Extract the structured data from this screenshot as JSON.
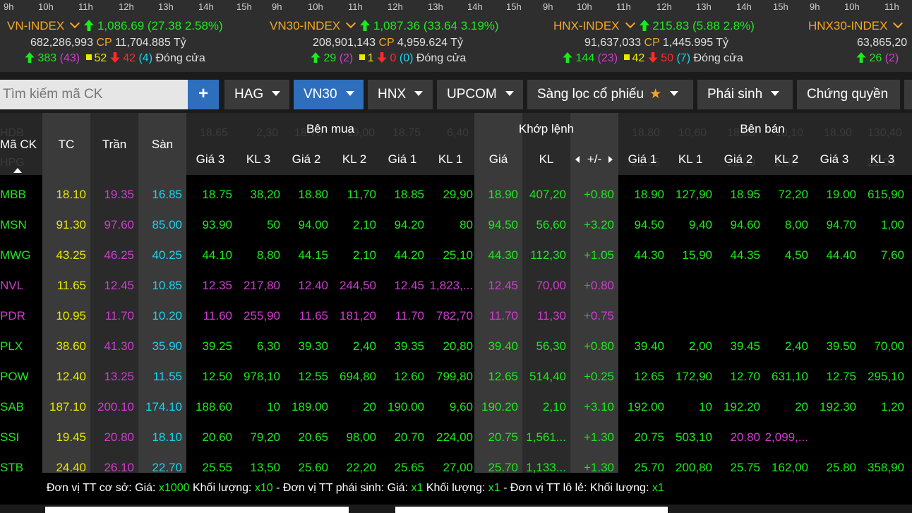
{
  "indices": [
    {
      "name": "VN-INDEX",
      "value": "1,086.69",
      "change": "(27.38 2.58%)",
      "volume": "682,286,993",
      "cp_label": "CP",
      "turnover": "11,704.885 Tỷ",
      "up": "383",
      "ceiling": "(43)",
      "unchanged": "52",
      "down": "42",
      "floor": "(4)",
      "status": "Đóng cửa",
      "hours": [
        "9h",
        "10h",
        "11h",
        "12h",
        "13h",
        "14h",
        "15h"
      ]
    },
    {
      "name": "VN30-INDEX",
      "value": "1,087.36",
      "change": "(33.64 3.19%)",
      "volume": "208,901,143",
      "cp_label": "CP",
      "turnover": "4,959.624 Tỷ",
      "up": "29",
      "ceiling": "(2)",
      "unchanged": "1",
      "down": "0",
      "floor": "(0)",
      "status": "Đóng cửa",
      "hours": [
        "9h",
        "10h",
        "11h",
        "12h",
        "13h",
        "14h",
        "15h"
      ]
    },
    {
      "name": "HNX-INDEX",
      "value": "215.83",
      "change": "(5.88 2.8%)",
      "volume": "91,637,033",
      "cp_label": "CP",
      "turnover": "1,445.995 Tỷ",
      "up": "144",
      "ceiling": "(23)",
      "unchanged": "42",
      "down": "50",
      "floor": "(7)",
      "status": "Đóng cửa",
      "hours": [
        "9h",
        "10h",
        "11h",
        "12h",
        "13h",
        "14h",
        "15h"
      ]
    },
    {
      "name": "HNX30-INDEX",
      "value": "",
      "change": "",
      "volume": "63,865,20",
      "cp_label": "",
      "turnover": "",
      "up": "26",
      "ceiling": "(2)",
      "unchanged": "",
      "down": "",
      "floor": "",
      "status": "",
      "hours": [
        "9h",
        "10h",
        "11h"
      ]
    }
  ],
  "toolbar": {
    "search_placeholder": "Tìm kiếm mã CK",
    "plus_label": "+",
    "buttons": [
      "HAG",
      "VN30",
      "HNX",
      "UPCOM",
      "Sàng lọc cổ phiếu",
      "Phái sinh",
      "Chứng quyền"
    ],
    "active_button": "VN30"
  },
  "table": {
    "headers": {
      "symbol": "Mã CK",
      "ref": "TC",
      "ceil": "Trần",
      "floor": "Sàn",
      "buy_group": "Bên mua",
      "match_group": "Khớp lệnh",
      "sell_group": "Bên bán",
      "price3": "Giá 3",
      "vol3": "KL 3",
      "price2": "Giá 2",
      "vol2": "KL 2",
      "price1": "Giá 1",
      "vol1": "KL 1",
      "match_price": "Giá",
      "match_vol": "KL",
      "change": "+/-"
    },
    "ghost_rows": [
      {
        "sym": "HDB",
        "vals": [
          "18.65",
          "2,30",
          "18.70",
          "19,00",
          "18.75",
          "6,40",
          "",
          "",
          "",
          "18.80",
          "10,60",
          "18.85",
          "10,10",
          "18.90",
          "130,40"
        ]
      },
      {
        "sym": "HPG",
        "vals": [
          "21.00",
          "",
          "",
          "",
          "",
          "",
          "",
          "",
          "",
          "21.95",
          "",
          "22.00",
          "2,85",
          "",
          "22.05"
        ]
      }
    ],
    "rows": [
      {
        "sym": "MBB",
        "tc": "18.10",
        "tran": "19.35",
        "san": "16.85",
        "b3": "18.75",
        "bv3": "38,20",
        "b2": "18.80",
        "bv2": "11,70",
        "b1": "18.85",
        "bv1": "29,90",
        "mp": "18.90",
        "mv": "407,20",
        "ch": "+0.80",
        "s1": "18.90",
        "sv1": "127,90",
        "s2": "18.95",
        "sv2": "72,20",
        "s3": "19.00",
        "sv3": "615,90",
        "color": "green"
      },
      {
        "sym": "MSN",
        "tc": "91.30",
        "tran": "97.60",
        "san": "85.00",
        "b3": "93.90",
        "bv3": "50",
        "b2": "94.00",
        "bv2": "2,10",
        "b1": "94.20",
        "bv1": "80",
        "mp": "94.50",
        "mv": "56,60",
        "ch": "+3.20",
        "s1": "94.50",
        "sv1": "9,40",
        "s2": "94.60",
        "sv2": "8,00",
        "s3": "94.70",
        "sv3": "1,00",
        "color": "green"
      },
      {
        "sym": "MWG",
        "tc": "43.25",
        "tran": "46.25",
        "san": "40.25",
        "b3": "44.10",
        "bv3": "8,80",
        "b2": "44.15",
        "bv2": "2,10",
        "b1": "44.20",
        "bv1": "25,10",
        "mp": "44.30",
        "mv": "112,30",
        "ch": "+1.05",
        "s1": "44.30",
        "sv1": "15,90",
        "s2": "44.35",
        "sv2": "4,50",
        "s3": "44.40",
        "sv3": "7,60",
        "color": "green"
      },
      {
        "sym": "NVL",
        "tc": "11.65",
        "tran": "12.45",
        "san": "10.85",
        "b3": "12.35",
        "bv3": "217,80",
        "b2": "12.40",
        "bv2": "244,50",
        "b1": "12.45",
        "bv1": "1,823,...",
        "mp": "12.45",
        "mv": "70,00",
        "ch": "+0.80",
        "s1": "",
        "sv1": "",
        "s2": "",
        "sv2": "",
        "s3": "",
        "sv3": "",
        "color": "purple"
      },
      {
        "sym": "PDR",
        "tc": "10.95",
        "tran": "11.70",
        "san": "10.20",
        "b3": "11.60",
        "bv3": "255,90",
        "b2": "11.65",
        "bv2": "181,20",
        "b1": "11.70",
        "bv1": "782,70",
        "mp": "11.70",
        "mv": "11,30",
        "ch": "+0.75",
        "s1": "",
        "sv1": "",
        "s2": "",
        "sv2": "",
        "s3": "",
        "sv3": "",
        "color": "purple"
      },
      {
        "sym": "PLX",
        "tc": "38.60",
        "tran": "41.30",
        "san": "35.90",
        "b3": "39.25",
        "bv3": "6,30",
        "b2": "39.30",
        "bv2": "2,40",
        "b1": "39.35",
        "bv1": "20,80",
        "mp": "39.40",
        "mv": "56,30",
        "ch": "+0.80",
        "s1": "39.40",
        "sv1": "2,00",
        "s2": "39.45",
        "sv2": "2,40",
        "s3": "39.50",
        "sv3": "70,00",
        "color": "green"
      },
      {
        "sym": "POW",
        "tc": "12.40",
        "tran": "13.25",
        "san": "11.55",
        "b3": "12.50",
        "bv3": "978,10",
        "b2": "12.55",
        "bv2": "694,80",
        "b1": "12.60",
        "bv1": "799,80",
        "mp": "12.65",
        "mv": "514,40",
        "ch": "+0.25",
        "s1": "12.65",
        "sv1": "172,90",
        "s2": "12.70",
        "sv2": "631,10",
        "s3": "12.75",
        "sv3": "295,10",
        "color": "green"
      },
      {
        "sym": "SAB",
        "tc": "187.10",
        "tran": "200.10",
        "san": "174.10",
        "b3": "188.60",
        "bv3": "10",
        "b2": "189.00",
        "bv2": "20",
        "b1": "190.00",
        "bv1": "9,60",
        "mp": "190.20",
        "mv": "2,10",
        "ch": "+3.10",
        "s1": "192.00",
        "sv1": "10",
        "s2": "192.20",
        "sv2": "20",
        "s3": "192.30",
        "sv3": "1,20",
        "color": "green"
      },
      {
        "sym": "SSI",
        "tc": "19.45",
        "tran": "20.80",
        "san": "18.10",
        "b3": "20.60",
        "bv3": "79,20",
        "b2": "20.65",
        "bv2": "98,00",
        "b1": "20.70",
        "bv1": "224,00",
        "mp": "20.75",
        "mv": "1,561...",
        "ch": "+1.30",
        "s1": "20.75",
        "sv1": "503,10",
        "s2": "20.80",
        "sv2": "2,099,...",
        "s3": "",
        "sv3": "",
        "color": "green",
        "s2color": "purple"
      },
      {
        "sym": "STB",
        "tc": "24.40",
        "tran": "26.10",
        "san": "22.70",
        "b3": "25.55",
        "bv3": "13,50",
        "b2": "25.60",
        "bv2": "22,20",
        "b1": "25.65",
        "bv1": "27,00",
        "mp": "25.70",
        "mv": "1,133...",
        "ch": "+1.30",
        "s1": "25.70",
        "sv1": "200,80",
        "s2": "25.75",
        "sv2": "162,00",
        "s3": "25.80",
        "sv3": "358,90",
        "color": "green"
      }
    ]
  },
  "footer": {
    "p1": "Đơn vị TT cơ sở: Giá:",
    "v1": "x1000",
    "p2": "Khối lượng:",
    "v2": "x10",
    "p3": "- Đơn vị TT phái sinh: Giá:",
    "v3": "x1",
    "p4": "Khối lượng:",
    "v4": "x1",
    "p5": "- Đơn vị TT lô lẻ: Khối lượng:",
    "v5": "x1"
  },
  "colors": {
    "green": "#1ee81e",
    "purple": "#d13cd1",
    "cyan": "#17d4f0",
    "yellow": "#e8e800",
    "orange": "#f5a623",
    "red": "#ff2a2a",
    "accent": "#2e6fbd"
  }
}
